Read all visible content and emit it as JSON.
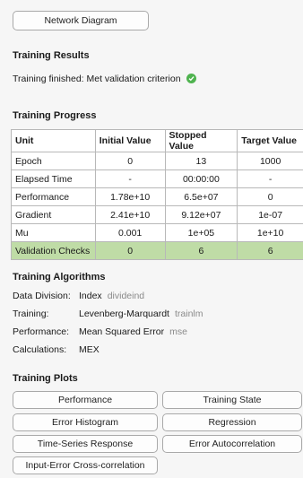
{
  "top_button": "Network Diagram",
  "results": {
    "heading": "Training Results",
    "status": "Training finished: Met validation criterion"
  },
  "progress": {
    "heading": "Training Progress",
    "columns": [
      "Unit",
      "Initial Value",
      "Stopped Value",
      "Target Value"
    ],
    "rows": [
      [
        "Epoch",
        "0",
        "13",
        "1000"
      ],
      [
        "Elapsed Time",
        "-",
        "00:00:00",
        "-"
      ],
      [
        "Performance",
        "1.78e+10",
        "6.5e+07",
        "0"
      ],
      [
        "Gradient",
        "2.41e+10",
        "9.12e+07",
        "1e-07"
      ],
      [
        "Mu",
        "0.001",
        "1e+05",
        "1e+10"
      ],
      [
        "Validation Checks",
        "0",
        "6",
        "6"
      ]
    ]
  },
  "algorithms": {
    "heading": "Training Algorithms",
    "items": [
      {
        "label": "Data Division:",
        "value": "Index",
        "fn": "divideind"
      },
      {
        "label": "Training:",
        "value": "Levenberg-Marquardt",
        "fn": "trainlm"
      },
      {
        "label": "Performance:",
        "value": "Mean Squared Error",
        "fn": "mse"
      },
      {
        "label": "Calculations:",
        "value": "MEX",
        "fn": ""
      }
    ]
  },
  "plots": {
    "heading": "Training Plots",
    "buttons": [
      "Performance",
      "Training State",
      "Error Histogram",
      "Regression",
      "Time-Series Response",
      "Error Autocorrelation",
      "Input-Error Cross-correlation"
    ]
  },
  "colors": {
    "highlight_row": "#bfdca6",
    "check": "#4fb34f"
  }
}
